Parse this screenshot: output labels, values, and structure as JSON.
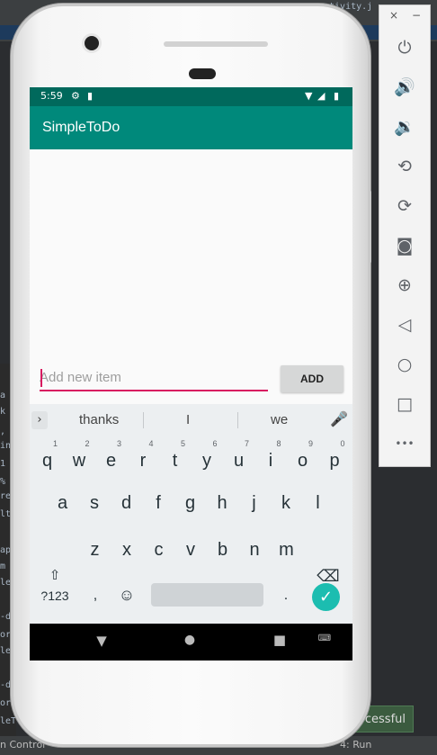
{
  "ide": {
    "tab_text": "ctivity.j",
    "status_left": "n Control",
    "run_label": "4: Run",
    "toast_text": "cessful",
    "code_fragments": [
      "a",
      "k",
      ",",
      "in",
      "1",
      "%",
      "re",
      "lt",
      "ap",
      "m",
      "le",
      "-d",
      "or",
      "le",
      "-d",
      "or",
      "leT"
    ]
  },
  "statusbar": {
    "time": "5:59",
    "gear_icon": "gear-icon",
    "sd_icon": "sd-card-icon",
    "wifi_icon": "wifi-icon",
    "signal_icon": "signal-icon",
    "battery_icon": "battery-icon"
  },
  "appbar": {
    "title": "SimpleToDo"
  },
  "input": {
    "placeholder": "Add new item",
    "value": ""
  },
  "add_button": {
    "label": "ADD"
  },
  "keyboard": {
    "suggestions": [
      "thanks",
      "I",
      "we"
    ],
    "row1": [
      {
        "k": "q",
        "h": "1"
      },
      {
        "k": "w",
        "h": "2"
      },
      {
        "k": "e",
        "h": "3"
      },
      {
        "k": "r",
        "h": "4"
      },
      {
        "k": "t",
        "h": "5"
      },
      {
        "k": "y",
        "h": "6"
      },
      {
        "k": "u",
        "h": "7"
      },
      {
        "k": "i",
        "h": "8"
      },
      {
        "k": "o",
        "h": "9"
      },
      {
        "k": "p",
        "h": "0"
      }
    ],
    "row2": [
      "a",
      "s",
      "d",
      "f",
      "g",
      "h",
      "j",
      "k",
      "l"
    ],
    "row3": [
      "z",
      "x",
      "c",
      "v",
      "b",
      "n",
      "m"
    ],
    "symbols_label": "?123",
    "comma": ",",
    "period": "."
  },
  "emulator_panel": {
    "close": "×",
    "minimize": "−",
    "buttons": [
      "power-icon",
      "volume-up-icon",
      "volume-down-icon",
      "rotate-left-icon",
      "rotate-right-icon",
      "camera-icon",
      "zoom-icon",
      "back-icon",
      "home-icon",
      "overview-icon",
      "more-icon"
    ],
    "more_label": "•••"
  },
  "colors": {
    "statusbar": "#00695c",
    "appbar": "#00897b",
    "accent": "#d81b60",
    "enter_key": "#1cbdb0"
  }
}
